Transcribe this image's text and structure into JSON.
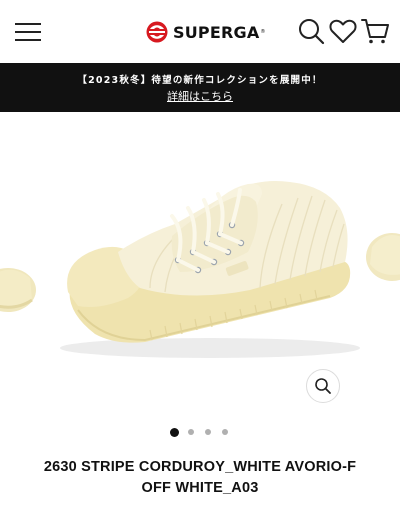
{
  "header": {
    "logo_text": "SUPERGA",
    "logo_reg": "®",
    "icons": [
      "hamburger-menu-icon",
      "search-icon",
      "heart-icon",
      "cart-icon"
    ]
  },
  "banner": {
    "announcement": "【2023秋冬】待望の新作コレクションを展開中！",
    "link_label": "詳細はこちら"
  },
  "gallery": {
    "slide_count": 4,
    "active_slide": 1,
    "zoom_icon": "zoom-icon"
  },
  "product": {
    "title_line1": "2630 STRIPE CORDUROY_WHITE AVORIO-F",
    "title_line2": "OFF WHITE_A03"
  },
  "colors": {
    "banner_bg": "#111111",
    "brand_red": "#d71920",
    "shoe_cream": "#f2e9bf"
  }
}
